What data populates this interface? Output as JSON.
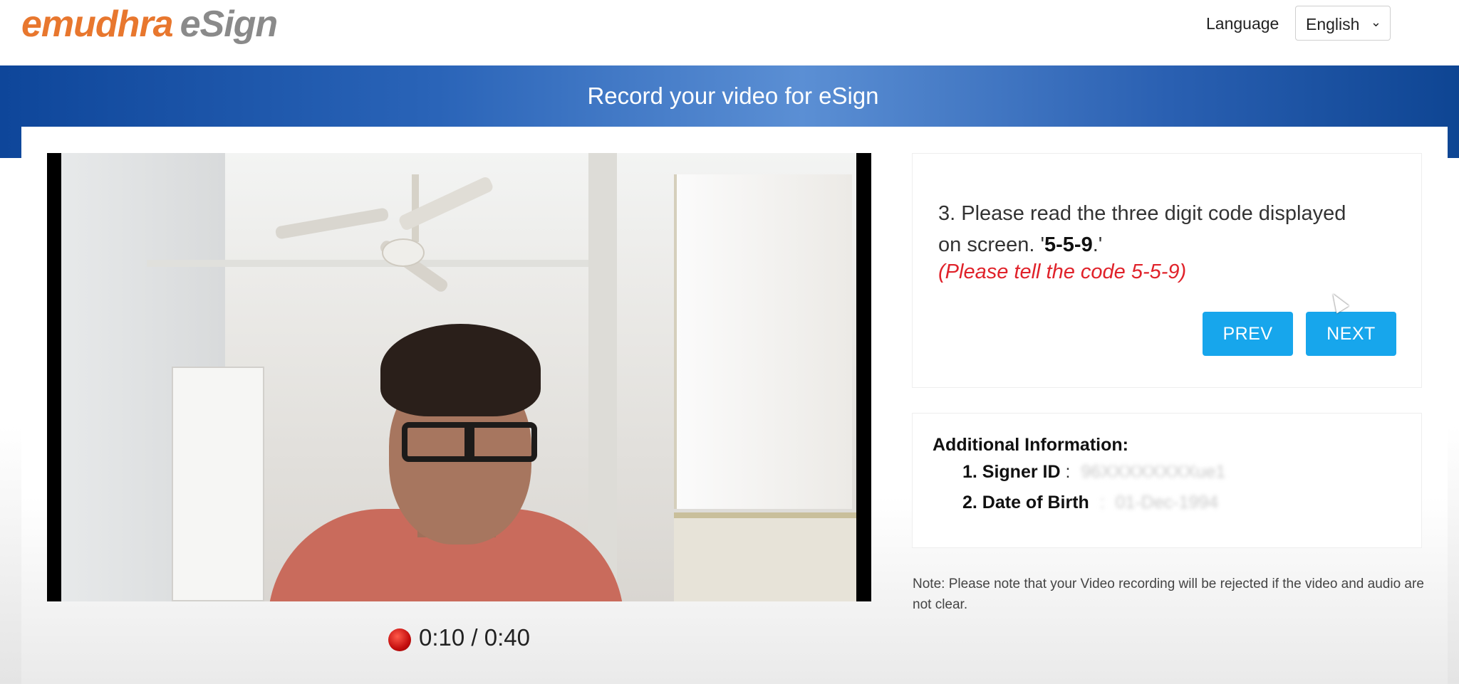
{
  "header": {
    "logo_brand": "emudhra",
    "logo_product": "eSign",
    "language_label": "Language",
    "language_value": "English"
  },
  "banner": {
    "title": "Record your video for eSign"
  },
  "video": {
    "timer": "0:10 / 0:40"
  },
  "instruction": {
    "line1": "3. Please read the three digit code displayed",
    "line2_prefix": "on screen. '",
    "line2_code": "5-5-9",
    "line2_suffix": ".'",
    "hint": "(Please tell the code 5-5-9)",
    "prev_label": "PREV",
    "next_label": "NEXT"
  },
  "additional_info": {
    "title": "Additional Information:",
    "signer_label": "1. Signer ID",
    "signer_sep": ":",
    "signer_value": "96XXXXXXXXue1",
    "dob_label": "2. Date of Birth",
    "dob_sep": ":",
    "dob_value": "01-Dec-1994"
  },
  "note": "Note: Please note that your Video recording will be rejected if the video and audio are not clear.",
  "colors": {
    "brand_orange": "#e8772e",
    "banner_blue": "#1550a4",
    "button_blue": "#17a6ec",
    "hint_red": "#e0222a"
  },
  "icons": {
    "record": "record-dot-icon",
    "dropdown": "chevron-down-icon",
    "cursor": "mouse-cursor-icon"
  }
}
